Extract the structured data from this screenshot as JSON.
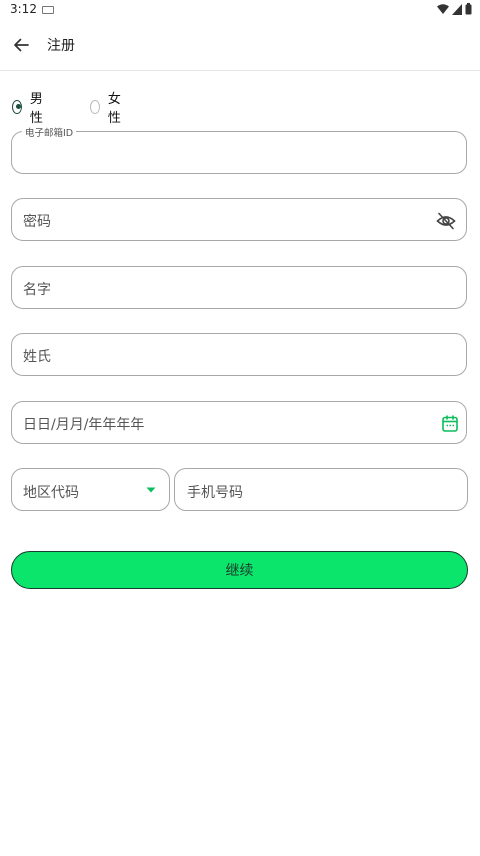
{
  "status_bar": {
    "time": "3:12"
  },
  "app_bar": {
    "title": "注册"
  },
  "gender": {
    "options": [
      {
        "label": "男性",
        "selected": true
      },
      {
        "label": "女性",
        "selected": false
      }
    ]
  },
  "form": {
    "email_label": "电子邮箱ID",
    "email_value": "",
    "password_placeholder": "密码",
    "first_name_placeholder": "名字",
    "last_name_placeholder": "姓氏",
    "dob_placeholder": "日日/月月/年年年年",
    "region_code_placeholder": "地区代码",
    "phone_placeholder": "手机号码"
  },
  "continue_label": "继续",
  "colors": {
    "accent": "#0be56b",
    "radio_checked": "#1f4d3d",
    "border": "#a8a8a8"
  }
}
